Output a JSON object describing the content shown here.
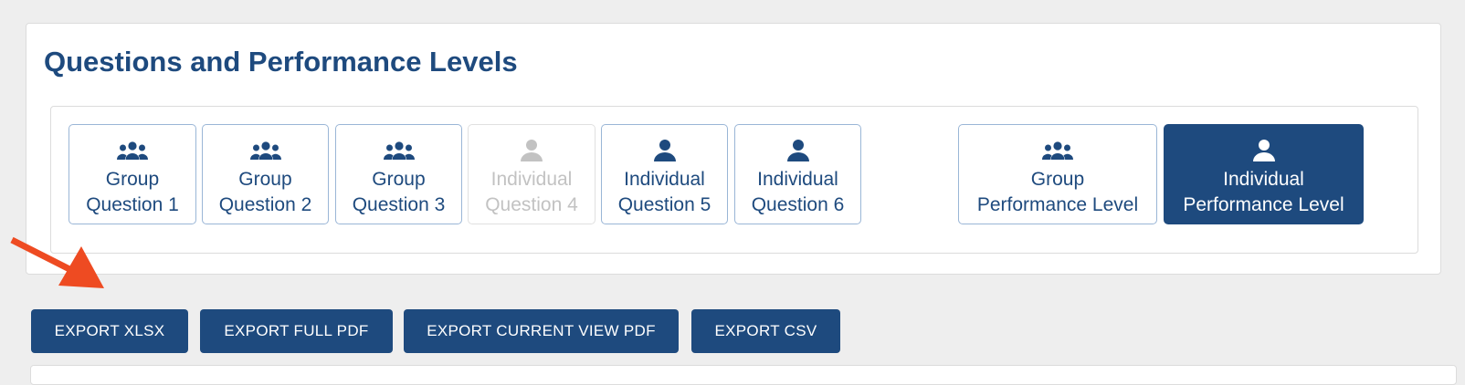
{
  "panel": {
    "title": "Questions and Performance Levels",
    "questions": [
      {
        "line1": "Group",
        "line2": "Question 1",
        "icon": "group-icon",
        "state": "normal"
      },
      {
        "line1": "Group",
        "line2": "Question 2",
        "icon": "group-icon",
        "state": "normal"
      },
      {
        "line1": "Group",
        "line2": "Question 3",
        "icon": "group-icon",
        "state": "normal"
      },
      {
        "line1": "Individual",
        "line2": "Question 4",
        "icon": "person-icon",
        "state": "disabled"
      },
      {
        "line1": "Individual",
        "line2": "Question 5",
        "icon": "person-icon",
        "state": "normal"
      },
      {
        "line1": "Individual",
        "line2": "Question 6",
        "icon": "person-icon",
        "state": "normal"
      }
    ],
    "performance": [
      {
        "line1": "Group",
        "line2": "Performance Level",
        "icon": "group-icon",
        "state": "normal"
      },
      {
        "line1": "Individual",
        "line2": "Performance Level",
        "icon": "person-icon",
        "state": "active"
      }
    ]
  },
  "exports": {
    "xlsx": "EXPORT XLSX",
    "full_pdf": "EXPORT FULL PDF",
    "current_view_pdf": "EXPORT CURRENT VIEW PDF",
    "csv": "EXPORT CSV"
  },
  "colors": {
    "primary": "#1e4a7e",
    "border": "#9ab6d6",
    "disabled": "#c2c2c2",
    "annotation_arrow": "#ee4b22",
    "background": "#eeeeee"
  }
}
